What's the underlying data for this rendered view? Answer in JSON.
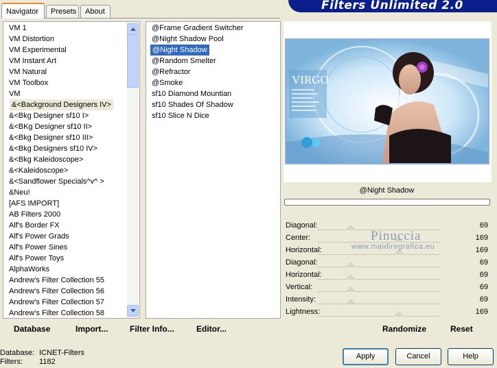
{
  "app": {
    "title": "Filters Unlimited 2.0"
  },
  "tabs": [
    {
      "label": "Navigator"
    },
    {
      "label": "Presets"
    },
    {
      "label": "About"
    }
  ],
  "categories": [
    "VM 1",
    "VM Distortion",
    "VM Experimental",
    "VM Instant Art",
    "VM Natural",
    "VM Toolbox",
    "VM",
    "&<Background Designers IV>",
    "&<Bkg Designer sf10 I>",
    "&<BKg Designer sf10 II>",
    "&<Bkg Designer sf10 III>",
    "&<Bkg Designers sf10 IV>",
    "&<Bkg Kaleidoscope>",
    "&<Kaleidoscope>",
    "&<Sandflower Specials^v^ >",
    "&Neu!",
    "[AFS IMPORT]",
    "AB Filters 2000",
    "Alf's Border FX",
    "Alf's Power Grads",
    "Alf's Power Sines",
    "Alf's Power Toys",
    "AlphaWorks",
    "Andrew's Filter Collection 55",
    "Andrew's Filter Collection 56",
    "Andrew's Filter Collection 57",
    "Andrew's Filter Collection 58"
  ],
  "selected_category": "&<Background Designers IV>",
  "filters": [
    "@Frame Gradient Switcher",
    "@Night Shadow Pool",
    "@Night Shadow",
    "@Random Smelter",
    "@Refractor",
    "@Smoke",
    "sf10 Diamond Mountian",
    "sf10 Shades Of Shadow",
    "sf10 Slice N Dice"
  ],
  "selected_filter": "@Night Shadow",
  "toolbar": {
    "database": "Database",
    "import": "Import...",
    "filter_info": "Filter Info...",
    "editor": "Editor..."
  },
  "preview": {
    "title_text": "VIRGO",
    "current_filter": "@Night Shadow"
  },
  "progress": 0,
  "sliders": [
    {
      "label": "Diagonal:",
      "value": "69",
      "fraction": 0.27
    },
    {
      "label": "Center:",
      "value": "169",
      "fraction": 0.66
    },
    {
      "label": "Horizontal:",
      "value": "169",
      "fraction": 0.66
    },
    {
      "label": "Diagonal:",
      "value": "69",
      "fraction": 0.27
    },
    {
      "label": "Horizontal:",
      "value": "69",
      "fraction": 0.27
    },
    {
      "label": "Vertical:",
      "value": "69",
      "fraction": 0.27
    },
    {
      "label": "Intensity:",
      "value": "69",
      "fraction": 0.27
    },
    {
      "label": "Lightness:",
      "value": "169",
      "fraction": 0.66
    }
  ],
  "watermark": {
    "name": "Pinuccia",
    "site": "www.maidiregrafica.eu"
  },
  "actions": {
    "randomize": "Randomize",
    "reset": "Reset"
  },
  "status": {
    "database_label": "Database:",
    "database_value": "ICNET-Filters",
    "filters_label": "Filters:",
    "filters_value": "1182"
  },
  "buttons": {
    "apply": "Apply",
    "cancel": "Cancel",
    "help": "Help"
  },
  "colors": {
    "accent": "#316ac5",
    "banner": "#0a1e8c",
    "tab_highlight": "#e68b2c"
  }
}
